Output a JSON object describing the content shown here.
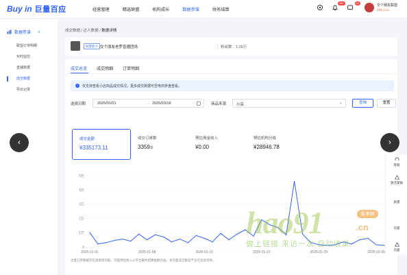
{
  "header": {
    "logo_en": "Buy in",
    "logo_cn": "巨量百应",
    "nav": [
      "经营管理",
      "精选联盟",
      "机构成长",
      "数据参谋",
      "财务结算"
    ],
    "active_nav": 3,
    "badge_msgs": "99+",
    "badge_notice": "15",
    "user_name": "交个朋友联盟",
    "user_role": "机构-MCN"
  },
  "sidebar": {
    "head": "数据参谋",
    "items": [
      "联盟订单明细",
      "实时监控",
      "直播数据",
      "成交数据",
      "导出记录"
    ],
    "active_index": 3
  },
  "breadcrumb": {
    "a": "成交数据",
    "b": "达人数据",
    "c": "数据详情",
    "sep": " / "
  },
  "anchor": {
    "tag": "抖音达人",
    "name": "交个朋友老罗直播团场",
    "fans_label": "粉丝数：",
    "fans_value": "1.28万"
  },
  "tabs": [
    "成交总览",
    "成交明细",
    "订单明细"
  ],
  "notice": "仅支持查看小店商品成交情况，更多成交数据可至电商罗盘查看。",
  "filters": {
    "date_label": "选择日期",
    "date_start": "2025/01/01",
    "date_sep": "→",
    "date_end": "2025/03/18",
    "source_label": "商品来源",
    "source_value": "小店",
    "query_btn": "查询",
    "reset_btn": "重置"
  },
  "metrics": [
    {
      "label": "成交金额",
      "value": "¥335173.11",
      "unit": ""
    },
    {
      "label": "成交订单数",
      "value": "3359",
      "unit": "单"
    },
    {
      "label": "预估佣金收入",
      "value": "¥0.00",
      "unit": ""
    },
    {
      "label": "预估机构分成",
      "value": "¥28946.78",
      "unit": ""
    }
  ],
  "chart_data": {
    "type": "line",
    "series": [
      {
        "values": [
          1.0,
          0.2,
          0.3,
          0.45,
          0.55,
          0.4,
          0.9,
          0.5,
          0.85,
          0.7,
          0.35,
          0.55,
          0.3,
          0.8,
          0.6,
          0.35,
          0.95,
          0.5,
          0.9,
          1.2,
          0.75,
          1.9,
          1.55,
          1.35,
          0.85,
          4.6,
          0.9,
          0.3,
          0.15,
          0.1,
          0.15,
          0.35,
          0.2,
          0.5,
          0.6,
          0.15,
          0.1
        ]
      }
    ],
    "x_ticks": [
      "2025-01-01",
      "2025-01-08",
      "2025-01-15",
      "2025-01-22",
      "2025-01-29",
      "2025-02-05"
    ],
    "y_ticks": [
      "0",
      "1万",
      "2万",
      "3万",
      "4万",
      "5万"
    ],
    "ylim": [
      0,
      5
    ],
    "color": "#2f62f5",
    "grid": true
  },
  "footnote": "注意订单数据存在退款等可能，可能预估收入以平台最终结算金额为准。本页面成交额是不含引流退货购...",
  "rail": [
    "客服",
    "激活掌报",
    "质量",
    "页面",
    "页面"
  ],
  "watermark": {
    "logo": "hao91",
    "pill": "免审核",
    "cn": ".cn",
    "slogan": "做上链接 来访一次 自动收录"
  }
}
